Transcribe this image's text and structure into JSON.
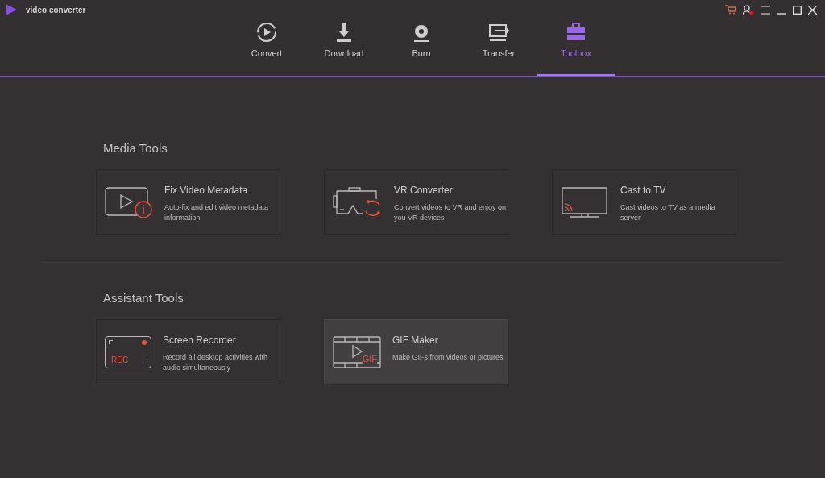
{
  "app": {
    "title": "video converter"
  },
  "tabs": [
    {
      "kind": "convert",
      "label": "Convert",
      "selected": false
    },
    {
      "kind": "download",
      "label": "Download",
      "selected": false
    },
    {
      "kind": "burn",
      "label": "Burn",
      "selected": false
    },
    {
      "kind": "transfer",
      "label": "Transfer",
      "selected": false
    },
    {
      "kind": "toolbox",
      "label": "Toolbox",
      "selected": true
    }
  ],
  "sections": [
    {
      "title": "Media Tools",
      "tools": [
        {
          "kind": "metadata",
          "title": "Fix Video Metadata",
          "description": "Auto-fix and edit video metadata information",
          "selected": false
        },
        {
          "kind": "vr",
          "title": "VR Converter",
          "description": "Convert videos to VR and enjoy on you VR devices",
          "selected": false
        },
        {
          "kind": "cast",
          "title": "Cast to TV",
          "description": "Cast videos to TV as a media server",
          "selected": false
        }
      ]
    },
    {
      "title": "Assistant Tools",
      "tools": [
        {
          "kind": "recorder",
          "title": "Screen Recorder",
          "description": "Record all desktop activities with audio simultaneously",
          "icon_text": "REC",
          "selected": false
        },
        {
          "kind": "gif",
          "title": "GIF Maker",
          "description": "Make GIFs from videos or pictures",
          "icon_text": "GIF",
          "selected": true
        }
      ]
    }
  ]
}
